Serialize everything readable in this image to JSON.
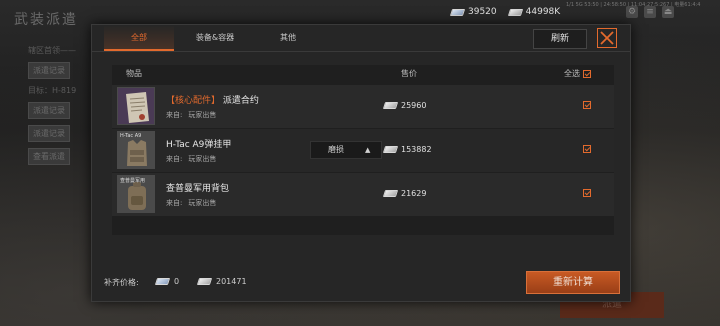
{
  "background": {
    "title": "武装派遣",
    "left_lines": [
      "辖区首领——",
      "派遣记录",
      "目标：H-819",
      "派遣记录",
      "派遣记录",
      "查看派遣"
    ],
    "status_text": "1/1 5G 53:50 | 24:58:50 | 11:04:27:5:267 | 电量61:4:4",
    "bottom_button": "派遣"
  },
  "currency": [
    {
      "icon": "bill-blue-icon",
      "value": "39520"
    },
    {
      "icon": "bill-white-icon",
      "value": "44998K"
    }
  ],
  "tabs": [
    {
      "label": "全部",
      "active": true
    },
    {
      "label": "装备&容器",
      "active": false
    },
    {
      "label": "其他",
      "active": false
    }
  ],
  "refresh_label": "刷新",
  "table": {
    "col_item": "物品",
    "col_price": "售价",
    "col_select": "全选",
    "select_all_checked": true
  },
  "rows": [
    {
      "core_tag": "【核心配件】",
      "name": "派遣合约",
      "source_label": "来自:",
      "source_value": "玩家出售",
      "price": "25960",
      "checked": true,
      "thumb_tag": "",
      "wear_label": ""
    },
    {
      "core_tag": "",
      "name": "H-Tac A9弹挂甲",
      "source_label": "来自:",
      "source_value": "玩家出售",
      "price": "153882",
      "checked": true,
      "thumb_tag": "H-Tac A9",
      "wear_label": "磨损"
    },
    {
      "core_tag": "",
      "name": "查普曼军用背包",
      "source_label": "来自:",
      "source_value": "玩家出售",
      "price": "21629",
      "checked": true,
      "thumb_tag": "查普曼军用",
      "wear_label": ""
    }
  ],
  "footer": {
    "label": "补齐价格:",
    "blue_value": "0",
    "white_value": "201471",
    "recalc_label": "重新计算"
  },
  "colors": {
    "accent": "#e36a2d",
    "panel": "#262626"
  }
}
